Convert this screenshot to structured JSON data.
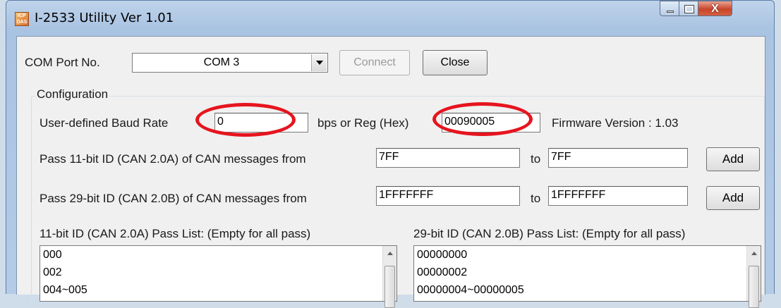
{
  "window": {
    "title": "I-2533 Utility Ver 1.01",
    "icon_text": "ICP DAS",
    "close_glyph": "X"
  },
  "com": {
    "label": "COM Port No.",
    "selected": "COM 3",
    "connect_label": "Connect",
    "close_label": "Close"
  },
  "config": {
    "group_title": "Configuration",
    "baud_label": "User-defined Baud Rate",
    "baud_value": "0",
    "bps_reg_label": "bps or Reg (Hex)",
    "reg_value": "00090005",
    "firmware": "Firmware Version : 1.03",
    "pass11_label": "Pass 11-bit ID (CAN 2.0A) of CAN messages from",
    "pass11_from": "7FF",
    "pass11_to_label": "to",
    "pass11_to": "7FF",
    "pass11_add": "Add",
    "pass29_label": "Pass 29-bit ID (CAN 2.0B) of CAN messages from",
    "pass29_from": "1FFFFFFF",
    "pass29_to_label": "to",
    "pass29_to": "1FFFFFFF",
    "pass29_add": "Add",
    "list11_label": "11-bit ID (CAN 2.0A) Pass List: (Empty for all pass)",
    "list11_items": [
      "000",
      "002",
      "004~005"
    ],
    "list29_label": "29-bit ID (CAN 2.0B) Pass List: (Empty for all pass)",
    "list29_items": [
      "00000000",
      "00000002",
      "00000004~00000005"
    ]
  },
  "colors": {
    "highlight_circle": "#e6141e",
    "window_frame": "#a9c3e2",
    "client_bg": "#f0f0f0"
  }
}
